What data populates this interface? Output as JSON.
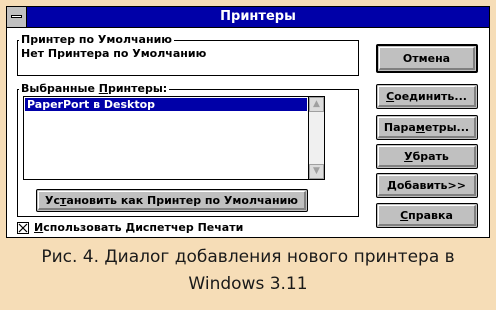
{
  "window": {
    "title": "Принтеры"
  },
  "default_printer": {
    "group_label": "Принтер по Умолчанию",
    "value": "Нет Принтера по Умолчанию"
  },
  "installed": {
    "label_prefix": "Выбранные ",
    "label_hotkey": "П",
    "label_rest": "ринтеры:",
    "items": [
      "PaperPort в Desktop"
    ]
  },
  "set_default_button": {
    "prefix": "Ус",
    "hotkey": "т",
    "rest": "ановить как Принтер по Умолчанию"
  },
  "use_print_manager": {
    "hotkey": "И",
    "rest": "спользовать Диспетчер Печати",
    "checked": true
  },
  "buttons": {
    "cancel": "Отмена",
    "connect_prefix": "",
    "connect_hotkey": "С",
    "connect_rest": "оединить...",
    "setup_prefix": "Пара",
    "setup_hotkey": "м",
    "setup_rest": "етры...",
    "remove_prefix": "",
    "remove_hotkey": "У",
    "remove_rest": "брать",
    "add_prefix": "",
    "add_hotkey": "Д",
    "add_rest": "обавить>>",
    "help_prefix": "",
    "help_hotkey": "С",
    "help_rest": "правка"
  },
  "caption": {
    "line1": "Рис. 4. Диалог добавления нового принтера в",
    "line2": "Windows 3.11"
  },
  "colors": {
    "titlebar": "#0000a8",
    "button_face": "#c0c0c0",
    "selection": "#0000a8",
    "page_background": "#f6ddb7"
  }
}
